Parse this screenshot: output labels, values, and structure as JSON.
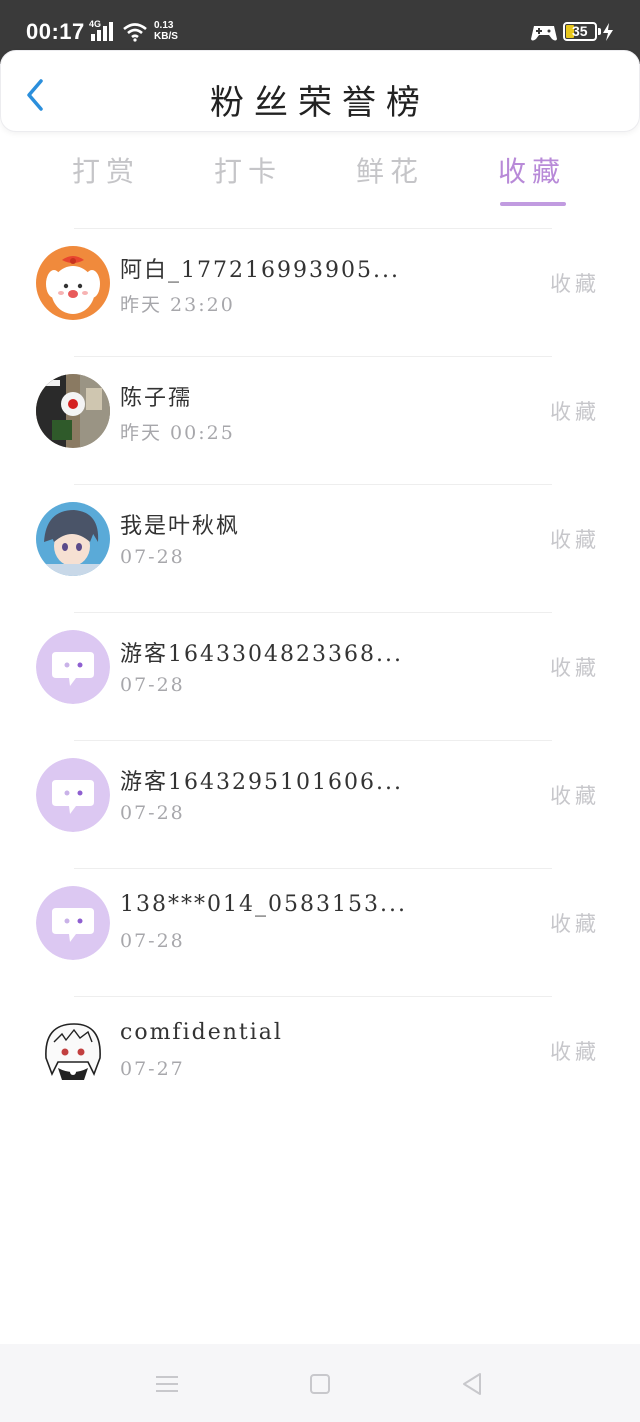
{
  "status_bar": {
    "time": "00:17",
    "network": "4G",
    "speed_value": "0.13",
    "speed_unit": "KB/S",
    "battery": "35",
    "icons": [
      "signal-icon",
      "wifi-icon",
      "game-controller-icon",
      "battery-icon",
      "charging-bolt-icon"
    ]
  },
  "header": {
    "title": "粉丝荣誉榜",
    "back_icon": "chevron-left-icon"
  },
  "tabs": [
    {
      "label": "打赏",
      "active": false
    },
    {
      "label": "打卡",
      "active": false
    },
    {
      "label": "鲜花",
      "active": false
    },
    {
      "label": "收藏",
      "active": true
    }
  ],
  "fans": [
    {
      "name": "阿白_177216993905...",
      "time": "昨天 23:20",
      "action": "收藏",
      "avatar": "dog-avatar"
    },
    {
      "name": "陈子孺",
      "time": "昨天 00:25",
      "action": "收藏",
      "avatar": "collage-avatar"
    },
    {
      "name": "我是叶秋枫",
      "time": "07-28",
      "action": "收藏",
      "avatar": "anime-boy-avatar"
    },
    {
      "name": "游客1643304823368...",
      "time": "07-28",
      "action": "收藏",
      "avatar": "default-chat-avatar"
    },
    {
      "name": "游客1643295101606...",
      "time": "07-28",
      "action": "收藏",
      "avatar": "default-chat-avatar"
    },
    {
      "name": "138***014_0583153...",
      "time": "07-28",
      "action": "收藏",
      "avatar": "default-chat-avatar"
    },
    {
      "name": "comfidential",
      "time": "07-27",
      "action": "收藏",
      "avatar": "sketch-girl-avatar"
    }
  ],
  "nav_bar": {
    "buttons": [
      "menu-icon",
      "home-square-icon",
      "back-triangle-icon"
    ]
  },
  "colors": {
    "accent": "#c19be0",
    "status_bar": "#3a3a3a",
    "default_avatar": "#dcc8f2",
    "back_icon": "#2b8fdc"
  }
}
